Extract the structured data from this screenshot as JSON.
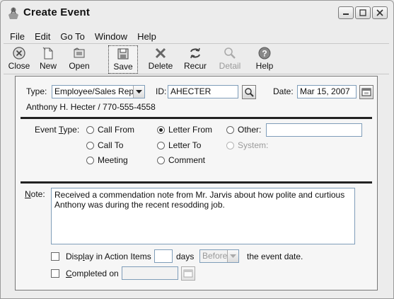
{
  "window": {
    "title": "Create Event"
  },
  "menu": [
    "File",
    "Edit",
    "Go To",
    "Window",
    "Help"
  ],
  "toolbar": [
    {
      "id": "close",
      "label": "Close",
      "icon": "close-circle-icon"
    },
    {
      "id": "new",
      "label": "New",
      "icon": "new-document-icon"
    },
    {
      "id": "open",
      "label": "Open",
      "icon": "open-folder-icon"
    },
    {
      "id": "save",
      "label": "Save",
      "icon": "save-disk-icon",
      "active": true
    },
    {
      "id": "delete",
      "label": "Delete",
      "icon": "delete-x-icon"
    },
    {
      "id": "recur",
      "label": "Recur",
      "icon": "recur-arrows-icon"
    },
    {
      "id": "detail",
      "label": "Detail",
      "icon": "magnifier-icon",
      "disabled": true
    },
    {
      "id": "help",
      "label": "Help",
      "icon": "help-question-icon"
    }
  ],
  "form": {
    "type_label": "Type:",
    "type_value": "Employee/Sales Rep",
    "id_label": "ID:",
    "id_value": "AHECTER",
    "date_label": "Date:",
    "date_value": "Mar 15, 2007",
    "contact_line": "Anthony H. Hecter / 770-555-4558",
    "event_type_label": "Event Type:",
    "event_types": {
      "call_from": "Call From",
      "call_to": "Call To",
      "meeting": "Meeting",
      "letter_from": "Letter From",
      "letter_to": "Letter To",
      "comment": "Comment",
      "other": "Other:",
      "system": "System:"
    },
    "selected_event_type": "Letter From",
    "other_value": "",
    "note_label": "Note:",
    "note_text": "Received a commendation note from Mr. Jarvis about how polite and curtious Anthony was during the recent resodding job.",
    "display_action_label": "Display in Action Items",
    "days_value": "",
    "days_label": "days",
    "before_value": "Before",
    "event_date_label": "the event date.",
    "completed_label": "Completed on",
    "completed_value": ""
  },
  "colors": {
    "window_bg": "#ececec",
    "panel_bg": "#f6f6f6",
    "field_border": "#7f9db9"
  }
}
